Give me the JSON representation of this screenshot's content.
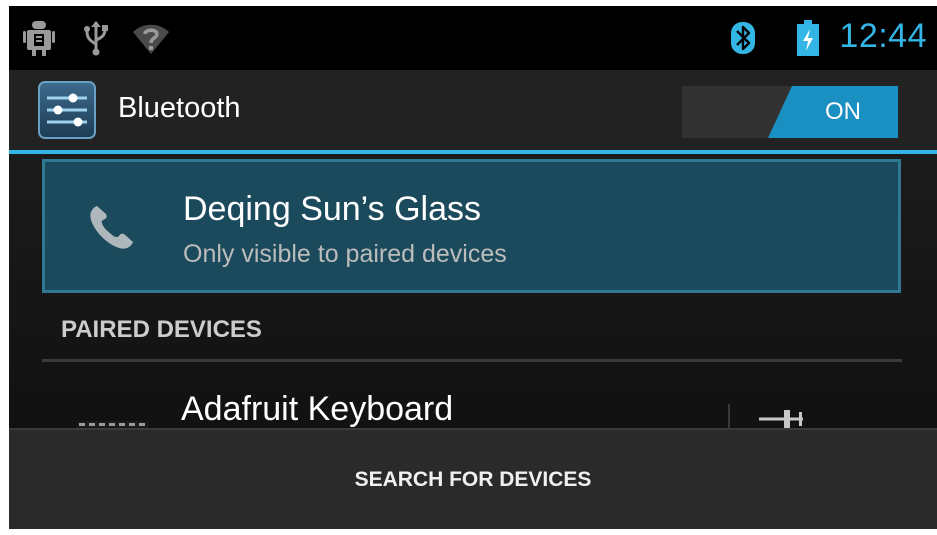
{
  "status_bar": {
    "icons": [
      "android-debug-icon",
      "usb-icon",
      "wifi-no-internet-icon",
      "bluetooth-icon",
      "battery-charging-icon"
    ],
    "time": "12:44",
    "accent_color": "#33b5e5"
  },
  "action_bar": {
    "icon": "settings-sliders-icon",
    "title": "Bluetooth",
    "toggle": {
      "state_label": "ON",
      "on": true,
      "color": "#1a8fc1"
    }
  },
  "this_device": {
    "icon": "phone-icon",
    "name": "Deqing Sun’s Glass",
    "subtitle": "Only visible to paired devices"
  },
  "paired_devices": {
    "header": "PAIRED DEVICES",
    "items": [
      {
        "icon": "keyboard-icon",
        "name": "Adafruit Keyboard",
        "action_icon": "device-settings-icon"
      }
    ]
  },
  "bottom_bar": {
    "button_label": "SEARCH FOR DEVICES"
  }
}
